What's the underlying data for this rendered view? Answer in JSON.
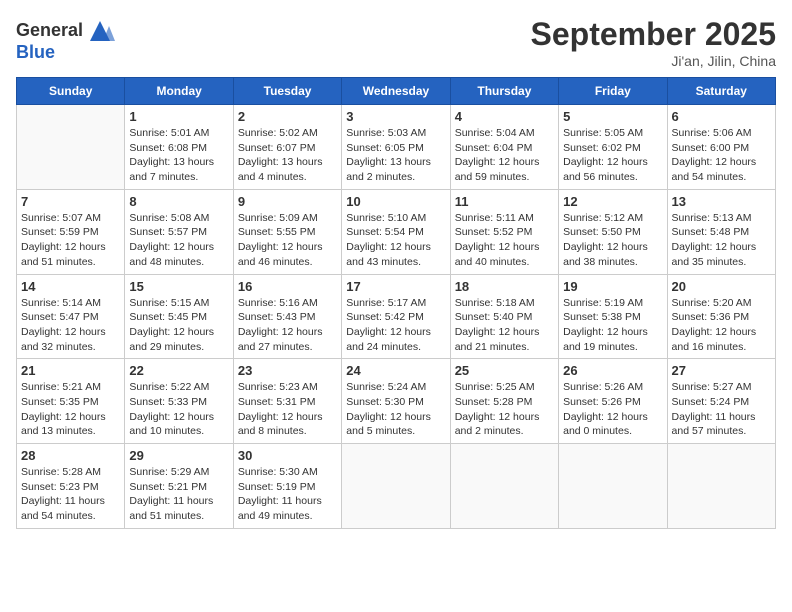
{
  "header": {
    "logo_line1": "General",
    "logo_line2": "Blue",
    "month": "September 2025",
    "location": "Ji'an, Jilin, China"
  },
  "weekdays": [
    "Sunday",
    "Monday",
    "Tuesday",
    "Wednesday",
    "Thursday",
    "Friday",
    "Saturday"
  ],
  "weeks": [
    [
      {
        "day": null
      },
      {
        "day": "1",
        "sunrise": "5:01 AM",
        "sunset": "6:08 PM",
        "daylight": "13 hours and 7 minutes."
      },
      {
        "day": "2",
        "sunrise": "5:02 AM",
        "sunset": "6:07 PM",
        "daylight": "13 hours and 4 minutes."
      },
      {
        "day": "3",
        "sunrise": "5:03 AM",
        "sunset": "6:05 PM",
        "daylight": "13 hours and 2 minutes."
      },
      {
        "day": "4",
        "sunrise": "5:04 AM",
        "sunset": "6:04 PM",
        "daylight": "12 hours and 59 minutes."
      },
      {
        "day": "5",
        "sunrise": "5:05 AM",
        "sunset": "6:02 PM",
        "daylight": "12 hours and 56 minutes."
      },
      {
        "day": "6",
        "sunrise": "5:06 AM",
        "sunset": "6:00 PM",
        "daylight": "12 hours and 54 minutes."
      }
    ],
    [
      {
        "day": "7",
        "sunrise": "5:07 AM",
        "sunset": "5:59 PM",
        "daylight": "12 hours and 51 minutes."
      },
      {
        "day": "8",
        "sunrise": "5:08 AM",
        "sunset": "5:57 PM",
        "daylight": "12 hours and 48 minutes."
      },
      {
        "day": "9",
        "sunrise": "5:09 AM",
        "sunset": "5:55 PM",
        "daylight": "12 hours and 46 minutes."
      },
      {
        "day": "10",
        "sunrise": "5:10 AM",
        "sunset": "5:54 PM",
        "daylight": "12 hours and 43 minutes."
      },
      {
        "day": "11",
        "sunrise": "5:11 AM",
        "sunset": "5:52 PM",
        "daylight": "12 hours and 40 minutes."
      },
      {
        "day": "12",
        "sunrise": "5:12 AM",
        "sunset": "5:50 PM",
        "daylight": "12 hours and 38 minutes."
      },
      {
        "day": "13",
        "sunrise": "5:13 AM",
        "sunset": "5:48 PM",
        "daylight": "12 hours and 35 minutes."
      }
    ],
    [
      {
        "day": "14",
        "sunrise": "5:14 AM",
        "sunset": "5:47 PM",
        "daylight": "12 hours and 32 minutes."
      },
      {
        "day": "15",
        "sunrise": "5:15 AM",
        "sunset": "5:45 PM",
        "daylight": "12 hours and 29 minutes."
      },
      {
        "day": "16",
        "sunrise": "5:16 AM",
        "sunset": "5:43 PM",
        "daylight": "12 hours and 27 minutes."
      },
      {
        "day": "17",
        "sunrise": "5:17 AM",
        "sunset": "5:42 PM",
        "daylight": "12 hours and 24 minutes."
      },
      {
        "day": "18",
        "sunrise": "5:18 AM",
        "sunset": "5:40 PM",
        "daylight": "12 hours and 21 minutes."
      },
      {
        "day": "19",
        "sunrise": "5:19 AM",
        "sunset": "5:38 PM",
        "daylight": "12 hours and 19 minutes."
      },
      {
        "day": "20",
        "sunrise": "5:20 AM",
        "sunset": "5:36 PM",
        "daylight": "12 hours and 16 minutes."
      }
    ],
    [
      {
        "day": "21",
        "sunrise": "5:21 AM",
        "sunset": "5:35 PM",
        "daylight": "12 hours and 13 minutes."
      },
      {
        "day": "22",
        "sunrise": "5:22 AM",
        "sunset": "5:33 PM",
        "daylight": "12 hours and 10 minutes."
      },
      {
        "day": "23",
        "sunrise": "5:23 AM",
        "sunset": "5:31 PM",
        "daylight": "12 hours and 8 minutes."
      },
      {
        "day": "24",
        "sunrise": "5:24 AM",
        "sunset": "5:30 PM",
        "daylight": "12 hours and 5 minutes."
      },
      {
        "day": "25",
        "sunrise": "5:25 AM",
        "sunset": "5:28 PM",
        "daylight": "12 hours and 2 minutes."
      },
      {
        "day": "26",
        "sunrise": "5:26 AM",
        "sunset": "5:26 PM",
        "daylight": "12 hours and 0 minutes."
      },
      {
        "day": "27",
        "sunrise": "5:27 AM",
        "sunset": "5:24 PM",
        "daylight": "11 hours and 57 minutes."
      }
    ],
    [
      {
        "day": "28",
        "sunrise": "5:28 AM",
        "sunset": "5:23 PM",
        "daylight": "11 hours and 54 minutes."
      },
      {
        "day": "29",
        "sunrise": "5:29 AM",
        "sunset": "5:21 PM",
        "daylight": "11 hours and 51 minutes."
      },
      {
        "day": "30",
        "sunrise": "5:30 AM",
        "sunset": "5:19 PM",
        "daylight": "11 hours and 49 minutes."
      },
      {
        "day": null
      },
      {
        "day": null
      },
      {
        "day": null
      },
      {
        "day": null
      }
    ]
  ]
}
